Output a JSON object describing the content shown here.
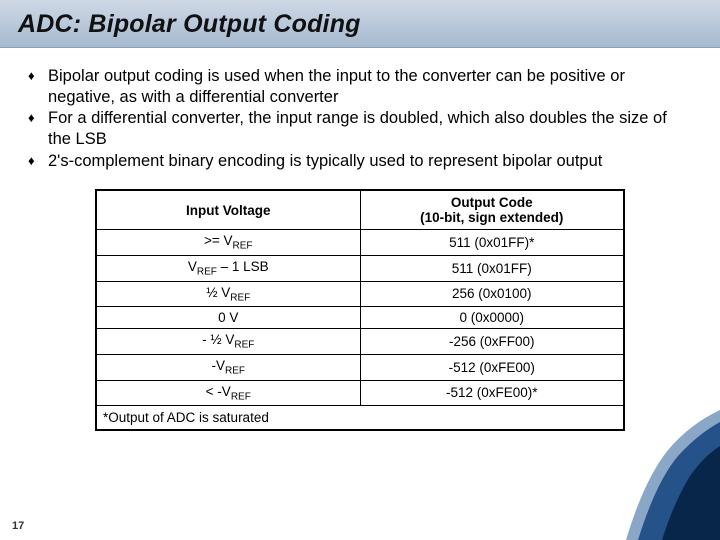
{
  "title": "ADC: Bipolar Output Coding",
  "bullets": [
    "Bipolar output coding is used when the input to the converter can be positive or negative, as with a differential converter",
    "For a differential converter, the input range is doubled, which also doubles the size of the LSB",
    "2's-complement binary encoding is typically used to represent bipolar output"
  ],
  "table": {
    "headers": [
      "Input Voltage",
      "Output Code\n(10-bit, sign extended)"
    ],
    "rows": [
      {
        "in_prefix": ">= V",
        "in_sub": "REF",
        "in_suffix": "",
        "out": "511 (0x01FF)*"
      },
      {
        "in_prefix": "V",
        "in_sub": "REF",
        "in_suffix": " – 1 LSB",
        "out": "511 (0x01FF)"
      },
      {
        "in_prefix": "½ V",
        "in_sub": "REF",
        "in_suffix": "",
        "out": "256 (0x0100)"
      },
      {
        "in_prefix": "0 V",
        "in_sub": "",
        "in_suffix": "",
        "out": "0 (0x0000)"
      },
      {
        "in_prefix": "- ½ V",
        "in_sub": "REF",
        "in_suffix": "",
        "out": "-256 (0xFF00)"
      },
      {
        "in_prefix": "-V",
        "in_sub": "REF",
        "in_suffix": "",
        "out": "-512 (0xFE00)"
      },
      {
        "in_prefix": "< -V",
        "in_sub": "REF",
        "in_suffix": "",
        "out": "-512 (0xFE00)*"
      }
    ],
    "footnote": "*Output of ADC is saturated"
  },
  "pageNumber": "17",
  "chart_data": {
    "type": "table",
    "title": "ADC Bipolar Output Coding (10-bit, sign extended)",
    "columns": [
      "Input Voltage",
      "Output Code Decimal",
      "Output Code Hex",
      "Saturated"
    ],
    "rows": [
      [
        ">= VREF",
        511,
        "0x01FF",
        true
      ],
      [
        "VREF - 1 LSB",
        511,
        "0x01FF",
        false
      ],
      [
        "1/2 VREF",
        256,
        "0x0100",
        false
      ],
      [
        "0 V",
        0,
        "0x0000",
        false
      ],
      [
        "-1/2 VREF",
        -256,
        "0xFF00",
        false
      ],
      [
        "-VREF",
        -512,
        "0xFE00",
        false
      ],
      [
        "< -VREF",
        -512,
        "0xFE00",
        true
      ]
    ]
  }
}
